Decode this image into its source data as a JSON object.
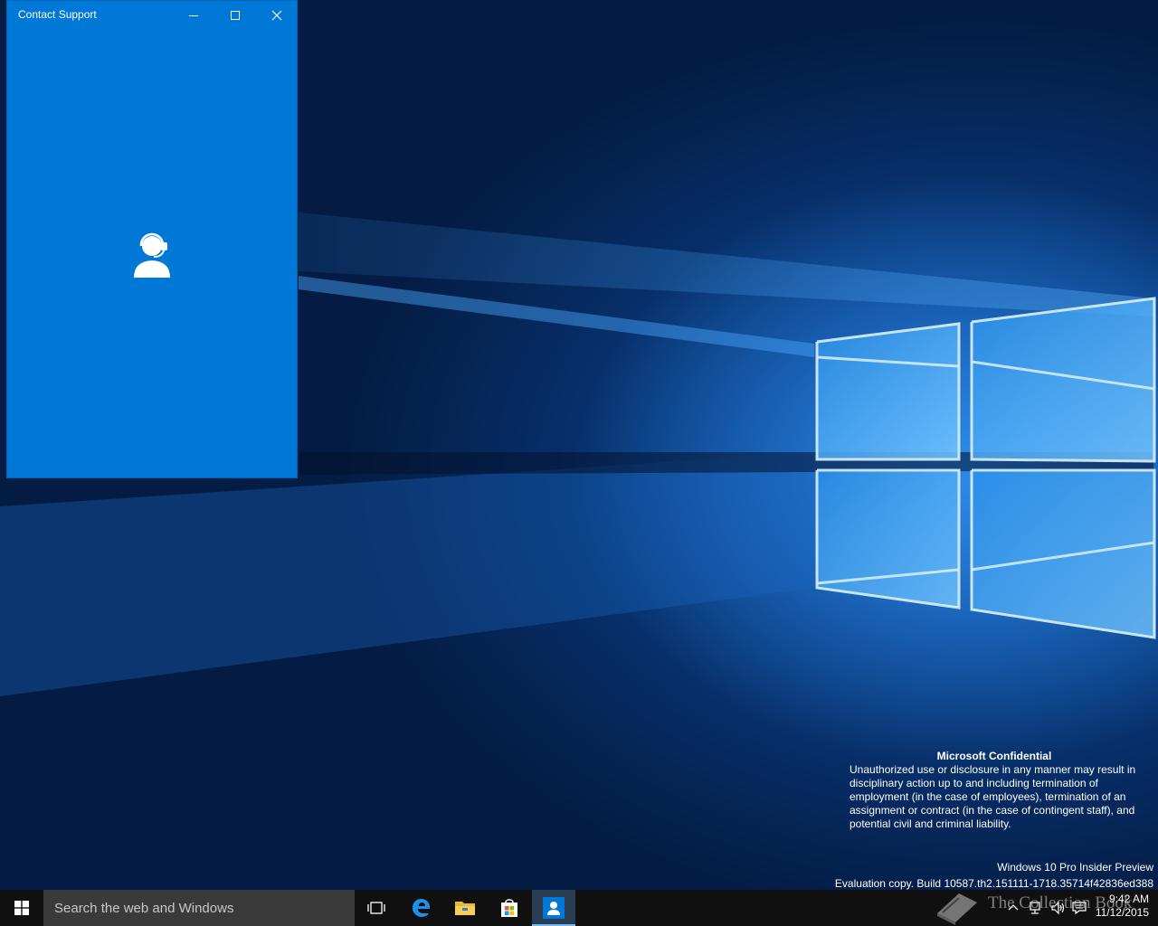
{
  "window": {
    "title": "Contact Support",
    "minimize_icon": "minimize-icon",
    "maximize_icon": "maximize-icon",
    "close_icon": "close-icon",
    "content_icon": "support-agent-icon",
    "background_color": "#0078d7"
  },
  "desktop": {
    "confidential": {
      "title": "Microsoft Confidential",
      "lines": [
        "Unauthorized use or disclosure in any manner may result in",
        "disciplinary action up to and including termination of",
        "employment (in the case of employees), termination of an",
        "assignment or contract (in the case of contingent staff), and",
        "potential civil and criminal liability."
      ]
    },
    "build": {
      "edition": "Windows 10 Pro Insider Preview",
      "evaluation": "Evaluation copy. Build 10587.th2.151111-1718.35714f42836ed388"
    }
  },
  "taskbar": {
    "start_icon": "windows-logo-icon",
    "search_placeholder": "Search the web and Windows",
    "pinned": [
      {
        "name": "task-view-icon"
      },
      {
        "name": "edge-icon"
      },
      {
        "name": "file-explorer-icon"
      },
      {
        "name": "store-icon"
      },
      {
        "name": "contact-support-icon",
        "active": true
      }
    ],
    "tray_icons": [
      "chevron-up-icon",
      "network-icon",
      "volume-icon",
      "action-center-icon"
    ],
    "clock": {
      "time": "9:42 AM",
      "date": "11/12/2015"
    }
  },
  "watermark": {
    "text": "The Collection Book"
  }
}
